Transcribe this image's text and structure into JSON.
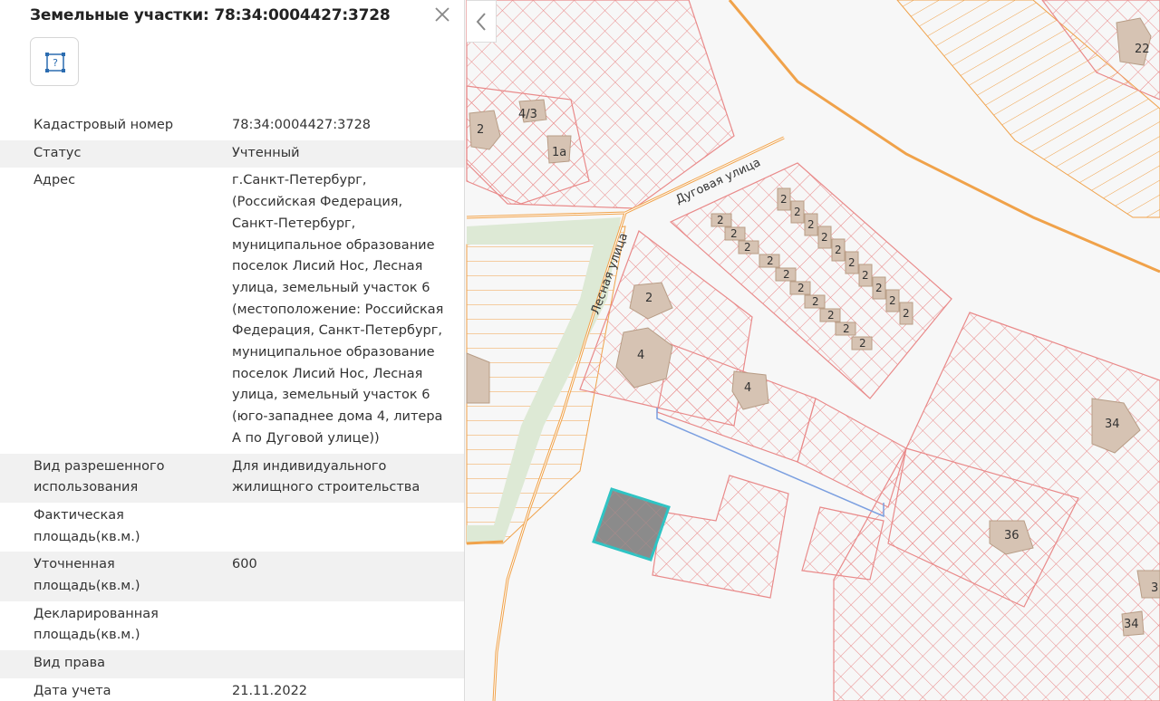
{
  "panel": {
    "title": "Земельные участки: 78:34:0004427:3728",
    "close_icon": "close-icon",
    "info_icon": "parcel-help-icon",
    "properties": [
      {
        "label": "Кадастровый номер",
        "value": "78:34:0004427:3728"
      },
      {
        "label": "Статус",
        "value": "Учтенный"
      },
      {
        "label": "Адрес",
        "value": "г.Санкт-Петербург, (Российская Федерация, Санкт-Петербург, муниципальное образование поселок Лисий Нос, Лесная улица, земельный участок 6 (местоположение: Российская Федерация, Санкт-Петербург, муниципальное образование поселок Лисий Нос, Лесная улица, земельный участок 6 (юго-западнее дома 4, литера А по Дуговой улице))"
      },
      {
        "label": "Вид разрешенного использования",
        "value": "Для индивидуального жилищного строительства"
      },
      {
        "label": "Фактическая площадь(кв.м.)",
        "value": ""
      },
      {
        "label": "Уточненная площадь(кв.м.)",
        "value": "600"
      },
      {
        "label": "Декларированная площадь(кв.м.)",
        "value": ""
      },
      {
        "label": "Вид права",
        "value": ""
      },
      {
        "label": "Дата учета",
        "value": "21.11.2022"
      }
    ]
  },
  "map": {
    "streets": {
      "dugovaya": "Дуговая улица",
      "lesnaya": "Лесная улица"
    },
    "house_numbers": {
      "h22": "22",
      "h2a": "2",
      "h43": "4/3",
      "h1a": "1а",
      "h2b": "2",
      "h4a": "4",
      "h4b": "4",
      "h34a": "34",
      "h36": "36",
      "h34b": "34",
      "h3": "3",
      "row2": "2"
    },
    "colors": {
      "parcel": "#e98a8a",
      "road": "#f0a24a",
      "building": "#d6c3b3",
      "selected_fill": "#8b8b8b",
      "selected_border": "#2ec4c4",
      "green": "#dde9d5",
      "blue_line": "#7b9fe0"
    }
  },
  "collapse_icon": "chevron-left-icon"
}
